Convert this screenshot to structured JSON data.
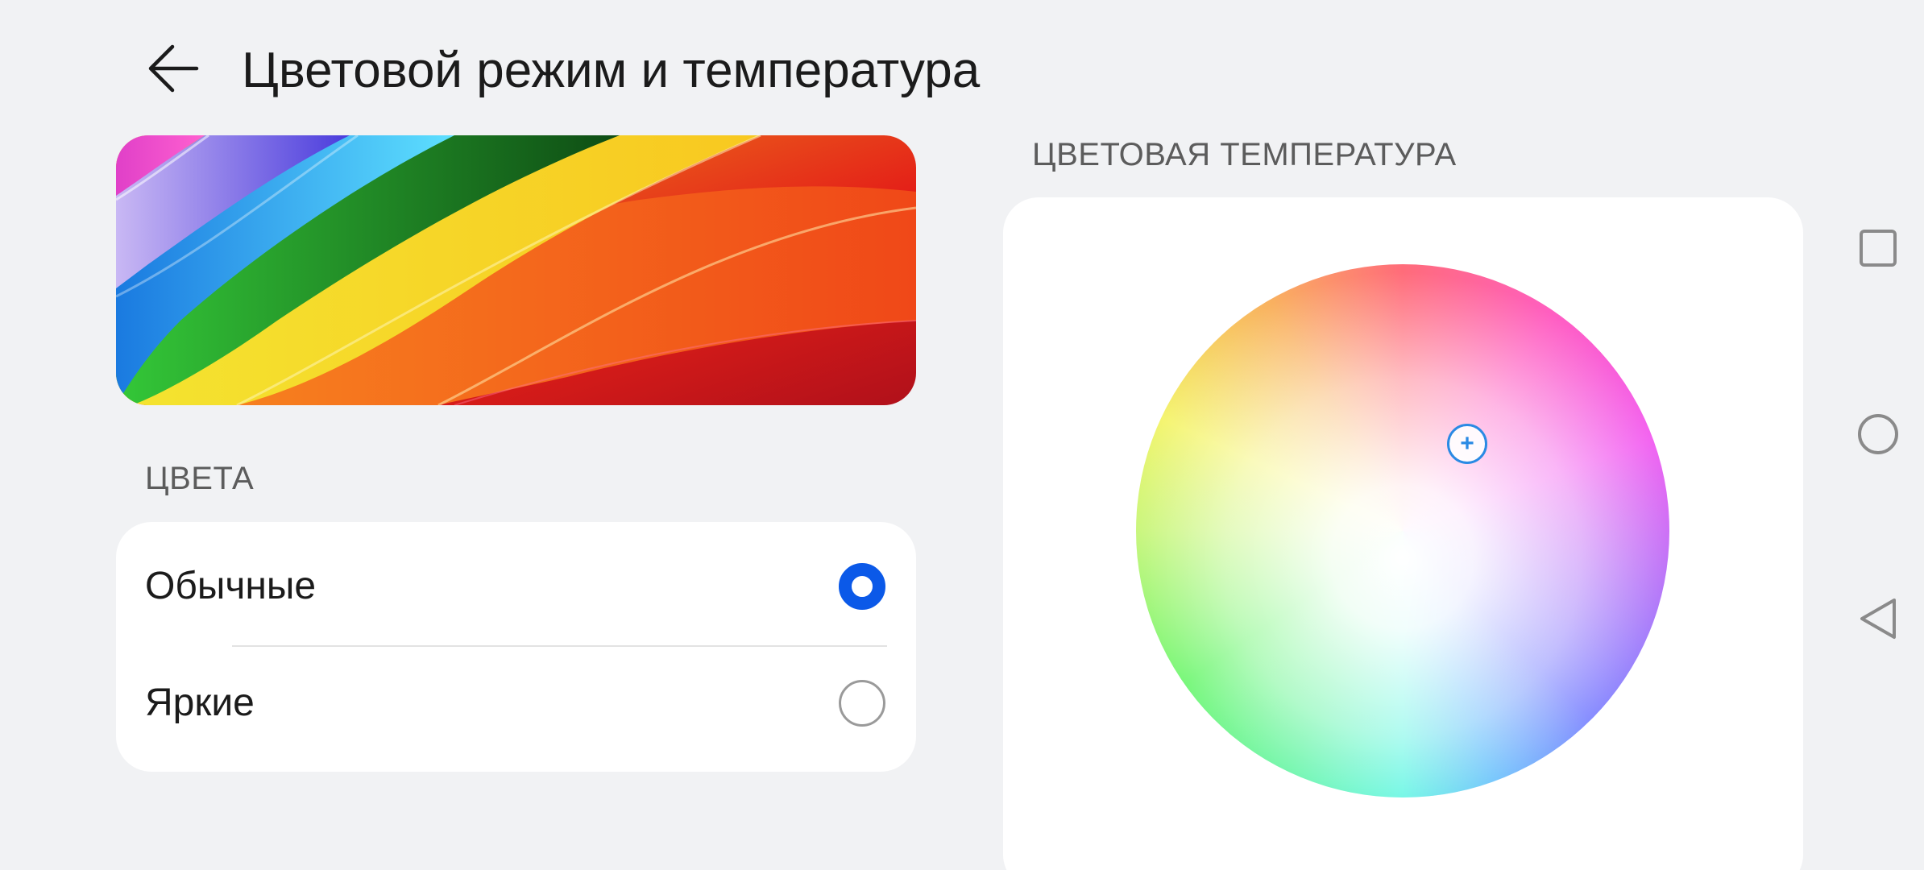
{
  "header": {
    "title": "Цветовой режим и температура",
    "back_icon": "arrow-left-icon"
  },
  "colors": {
    "section_title": "ЦВЕТА",
    "options": [
      {
        "label": "Обычные",
        "selected": true
      },
      {
        "label": "Яркие",
        "selected": false
      }
    ],
    "accent_color": "#0b59e8"
  },
  "temperature": {
    "section_title": "ЦВЕТОВАЯ ТЕМПЕРАТУРА",
    "handle_icon": "plus-icon",
    "handle_symbol": "+"
  },
  "navigation": {
    "recent_icon": "square-icon",
    "home_icon": "circle-icon",
    "back_icon": "triangle-back-icon"
  }
}
